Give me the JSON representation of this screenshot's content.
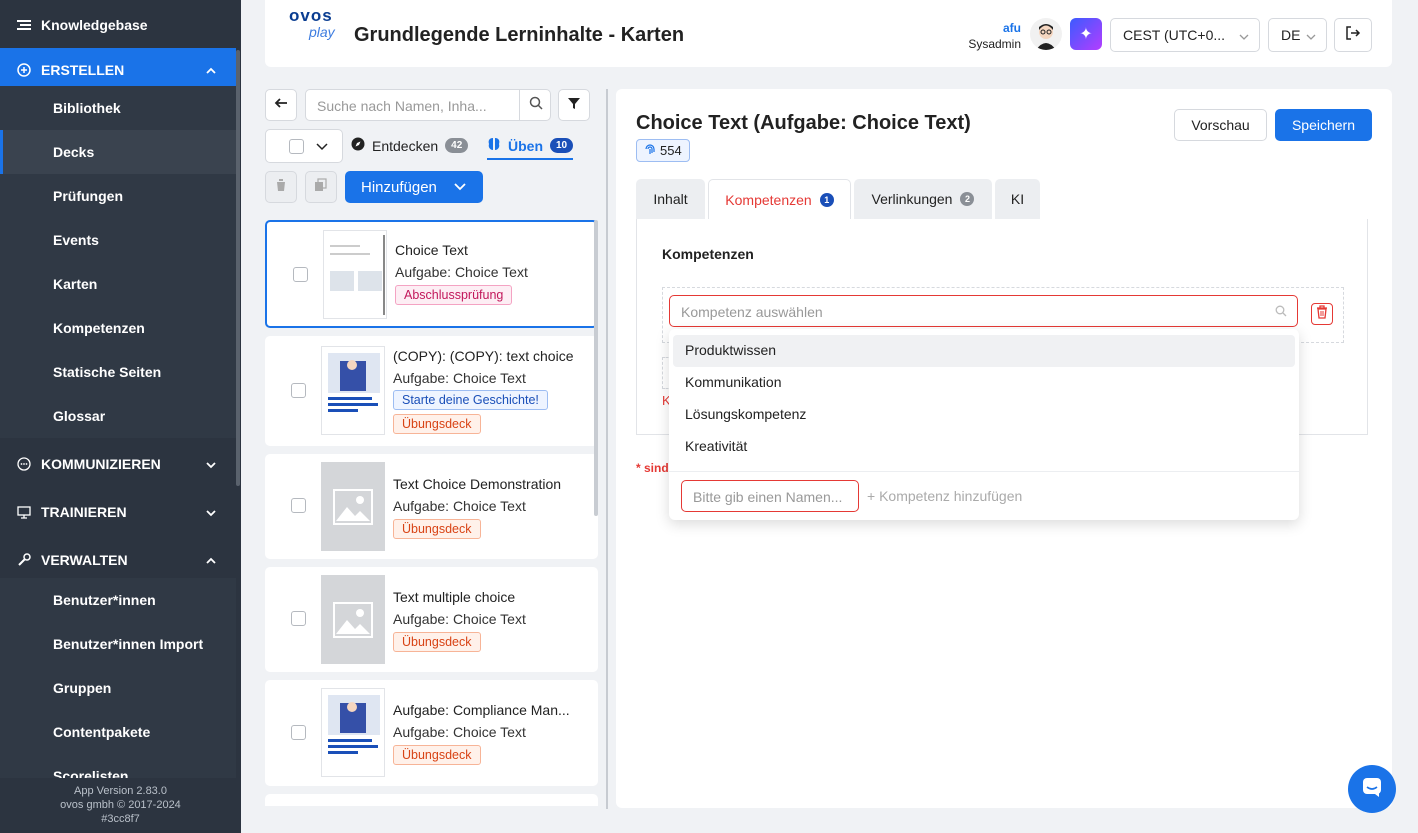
{
  "sidebar": {
    "brand": "Knowledgebase",
    "sections": [
      {
        "label": "ERSTELLEN"
      },
      {
        "label": "KOMMUNIZIEREN"
      },
      {
        "label": "TRAINIEREN"
      },
      {
        "label": "VERWALTEN"
      }
    ],
    "erstellen_items": [
      "Bibliothek",
      "Decks",
      "Prüfungen",
      "Events",
      "Karten",
      "Kompetenzen",
      "Statische Seiten",
      "Glossar"
    ],
    "verwalten_items": [
      "Benutzer*innen",
      "Benutzer*innen Import",
      "Gruppen",
      "Contentpakete",
      "Scorelisten"
    ],
    "footer": {
      "version": "App Version 2.83.0",
      "company": "ovos gmbh © 2017-2024",
      "hash": "#3cc8f7"
    }
  },
  "header": {
    "logo_top": "ovos",
    "logo_bottom": "play",
    "title": "Grundlegende Lerninhalte - Karten",
    "user_name": "afu",
    "user_role": "Sysadmin",
    "timezone": "CEST (UTC+0...",
    "language": "DE"
  },
  "left": {
    "search_placeholder": "Suche nach Namen, Inha...",
    "tabs": [
      {
        "label": "Entdecken",
        "count": "42"
      },
      {
        "label": "Üben",
        "count": "10"
      }
    ],
    "add_label": "Hinzufügen",
    "cards": [
      {
        "title": "Choice Text",
        "subtitle": "Aufgabe: Choice Text",
        "tags": [
          "Abschlussprüfung"
        ]
      },
      {
        "title": "(COPY): (COPY): text choice",
        "subtitle": "Aufgabe: Choice Text",
        "tags": [
          "Starte deine Geschichte!",
          "Übungsdeck"
        ]
      },
      {
        "title": "Text Choice Demonstration",
        "subtitle": "Aufgabe: Choice Text",
        "tags": [
          "Übungsdeck"
        ]
      },
      {
        "title": "Text multiple choice",
        "subtitle": "Aufgabe: Choice Text",
        "tags": [
          "Übungsdeck"
        ]
      },
      {
        "title": "Aufgabe: Compliance Man...",
        "subtitle": "Aufgabe: Choice Text",
        "tags": [
          "Übungsdeck"
        ]
      }
    ]
  },
  "right": {
    "title": "Choice Text (Aufgabe: Choice Text)",
    "chip_value": "554",
    "preview_label": "Vorschau",
    "save_label": "Speichern",
    "tabs": [
      {
        "label": "Inhalt"
      },
      {
        "label": "Kompetenzen",
        "badge": "1"
      },
      {
        "label": "Verlinkungen",
        "badge": "2"
      },
      {
        "label": "KI"
      }
    ],
    "section_title": "Kompetenzen",
    "select_placeholder": "Kompetenz auswählen",
    "options": [
      "Produktwissen",
      "Kommunikation",
      "Lösungskompetenz",
      "Kreativität"
    ],
    "new_name_placeholder": "Bitte gib einen Namen...",
    "add_competence_label": "+ Kompetenz hinzufügen",
    "error_fragment": "K",
    "required_fragment": "* sind"
  }
}
